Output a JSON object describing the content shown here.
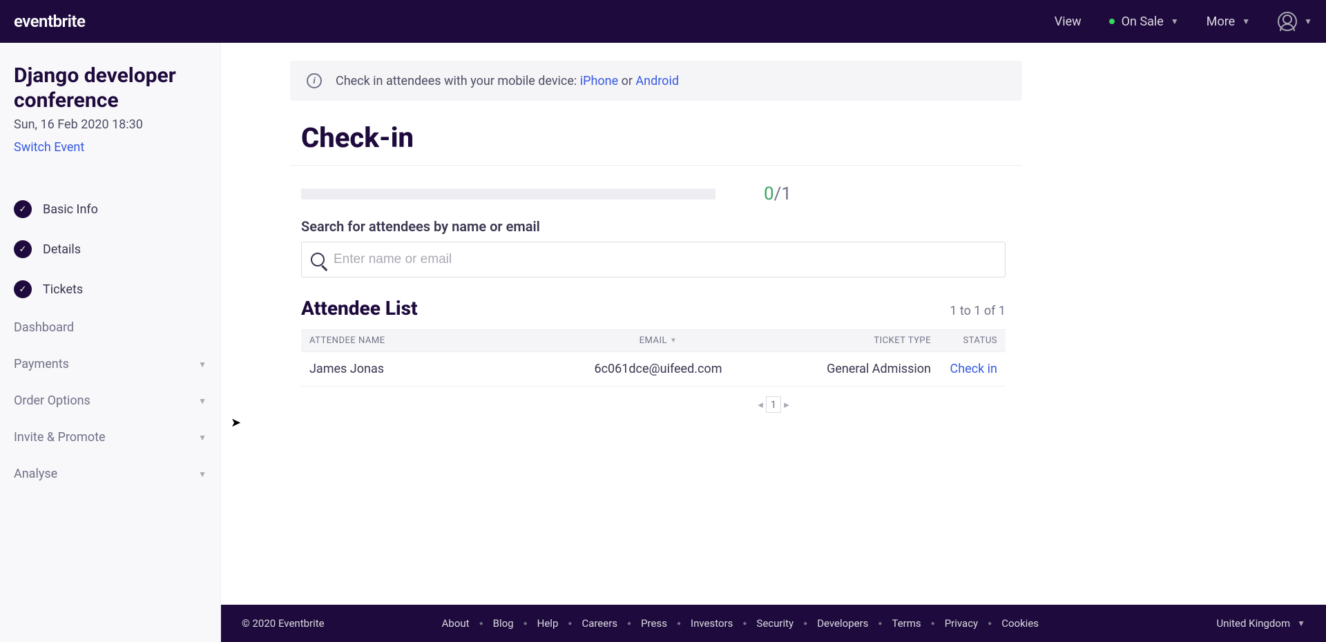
{
  "header": {
    "logo": "eventbrite",
    "view": "View",
    "status": "On Sale",
    "more": "More"
  },
  "sidebar": {
    "event_title": "Django developer conference",
    "event_date": "Sun, 16 Feb 2020 18:30",
    "switch": "Switch Event",
    "steps": {
      "basic_info": "Basic Info",
      "details": "Details",
      "tickets": "Tickets"
    },
    "items": {
      "dashboard": "Dashboard",
      "payments": "Payments",
      "order_options": "Order Options",
      "invite_promote": "Invite & Promote",
      "analyse": "Analyse"
    }
  },
  "banner": {
    "text": "Check in attendees with your mobile device: ",
    "iphone": "iPhone",
    "or": " or ",
    "android": "Android"
  },
  "page": {
    "title": "Check-in",
    "progress_done": "0",
    "progress_sep": "/",
    "progress_total": "1",
    "search_label": "Search for attendees by name or email",
    "search_placeholder": "Enter name or email",
    "list_title": "Attendee List",
    "list_count": "1 to 1 of 1"
  },
  "table": {
    "col_name": "ATTENDEE NAME",
    "col_email": "EMAIL",
    "col_type": "TICKET TYPE",
    "col_status": "STATUS",
    "row0": {
      "name": "James Jonas",
      "email": "6c061dce@uifeed.com",
      "type": "General Admission",
      "action": "Check in"
    }
  },
  "pager": {
    "page": "1"
  },
  "footer": {
    "copyright": "© 2020 Eventbrite",
    "links": {
      "about": "About",
      "blog": "Blog",
      "help": "Help",
      "careers": "Careers",
      "press": "Press",
      "investors": "Investors",
      "security": "Security",
      "developers": "Developers",
      "terms": "Terms",
      "privacy": "Privacy",
      "cookies": "Cookies"
    },
    "region": "United Kingdom"
  }
}
